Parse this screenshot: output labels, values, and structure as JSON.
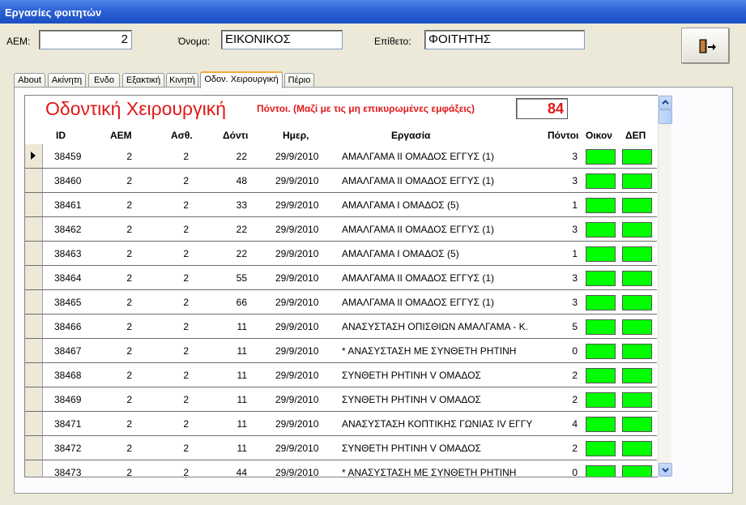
{
  "window": {
    "title": "Εργασίες φοιτητών"
  },
  "form": {
    "aem_label": "ΑΕΜ:",
    "aem_value": "2",
    "name_label": "Όνομα:",
    "name_value": "ΕΙΚΟΝΙΚΟΣ",
    "surname_label": "Επίθετο:",
    "surname_value": "ΦΟΙΤΗΤΗΣ"
  },
  "exit_button": {
    "icon": "exit-door-icon"
  },
  "tabs": [
    {
      "label": "About"
    },
    {
      "label": "Ακίνητη"
    },
    {
      "label": "Ενδο"
    },
    {
      "label": "Εξακτική"
    },
    {
      "label": "Κινητή"
    },
    {
      "label": "Οδον. Χειρουργική"
    },
    {
      "label": "Πέριο"
    }
  ],
  "subform": {
    "title": "Οδοντική Χειρουργική",
    "points_note": "Πόντοι. (Μαζί με τις μη επικυρωμένες εμφάξεις)",
    "points_total": "84",
    "columns": [
      "ID",
      "ΑΕΜ",
      "Ασθ.",
      "Δόντι",
      "Ημερ,",
      "Εργασία",
      "Πόντοι",
      "Οικον",
      "ΔΕΠ"
    ],
    "check_color": "#00ff00",
    "rows": [
      {
        "id": "38459",
        "aem": "2",
        "patient": "2",
        "tooth": "22",
        "date": "29/9/2010",
        "task": "ΑΜΑΛΓΑΜΑ ΙΙ ΟΜΑΔΟΣ ΕΓΓΥΣ (1)",
        "points": "3"
      },
      {
        "id": "38460",
        "aem": "2",
        "patient": "2",
        "tooth": "48",
        "date": "29/9/2010",
        "task": "ΑΜΑΛΓΑΜΑ ΙΙ ΟΜΑΔΟΣ ΕΓΓΥΣ (1)",
        "points": "3"
      },
      {
        "id": "38461",
        "aem": "2",
        "patient": "2",
        "tooth": "33",
        "date": "29/9/2010",
        "task": "ΑΜΑΛΓΑΜΑ Ι ΟΜΑΔΟΣ (5)",
        "points": "1"
      },
      {
        "id": "38462",
        "aem": "2",
        "patient": "2",
        "tooth": "22",
        "date": "29/9/2010",
        "task": "ΑΜΑΛΓΑΜΑ ΙΙ ΟΜΑΔΟΣ ΕΓΓΥΣ (1)",
        "points": "3"
      },
      {
        "id": "38463",
        "aem": "2",
        "patient": "2",
        "tooth": "22",
        "date": "29/9/2010",
        "task": "ΑΜΑΛΓΑΜΑ Ι ΟΜΑΔΟΣ (5)",
        "points": "1"
      },
      {
        "id": "38464",
        "aem": "2",
        "patient": "2",
        "tooth": "55",
        "date": "29/9/2010",
        "task": "ΑΜΑΛΓΑΜΑ ΙΙ ΟΜΑΔΟΣ ΕΓΓΥΣ (1)",
        "points": "3"
      },
      {
        "id": "38465",
        "aem": "2",
        "patient": "2",
        "tooth": "66",
        "date": "29/9/2010",
        "task": "ΑΜΑΛΓΑΜΑ ΙΙ ΟΜΑΔΟΣ ΕΓΓΥΣ (1)",
        "points": "3"
      },
      {
        "id": "38466",
        "aem": "2",
        "patient": "2",
        "tooth": "11",
        "date": "29/9/2010",
        "task": "ΑΝΑΣΥΣΤΑΣΗ ΟΠΙΣΘΙΩΝ ΑΜΑΛΓΑΜΑ - Κ.",
        "points": "5"
      },
      {
        "id": "38467",
        "aem": "2",
        "patient": "2",
        "tooth": "11",
        "date": "29/9/2010",
        "task": "* ΑΝΑΣΥΣΤΑΣΗ ΜΕ ΣΥΝΘΕΤΗ ΡΗΤΙΝΗ",
        "points": "0"
      },
      {
        "id": "38468",
        "aem": "2",
        "patient": "2",
        "tooth": "11",
        "date": "29/9/2010",
        "task": "ΣΥΝΘΕΤΗ ΡΗΤΙΝΗ V ΟΜΑΔΟΣ",
        "points": "2"
      },
      {
        "id": "38469",
        "aem": "2",
        "patient": "2",
        "tooth": "11",
        "date": "29/9/2010",
        "task": "ΣΥΝΘΕΤΗ ΡΗΤΙΝΗ V ΟΜΑΔΟΣ",
        "points": "2"
      },
      {
        "id": "38471",
        "aem": "2",
        "patient": "2",
        "tooth": "11",
        "date": "29/9/2010",
        "task": "ΑΝΑΣΥΣΤΑΣΗ ΚΟΠΤΙΚΗΣ ΓΩΝΙΑΣ ΙV ΕΓΓΥ",
        "points": "4"
      },
      {
        "id": "38472",
        "aem": "2",
        "patient": "2",
        "tooth": "11",
        "date": "29/9/2010",
        "task": "ΣΥΝΘΕΤΗ ΡΗΤΙΝΗ V ΟΜΑΔΟΣ",
        "points": "2"
      },
      {
        "id": "38473",
        "aem": "2",
        "patient": "2",
        "tooth": "44",
        "date": "29/9/2010",
        "task": "* ΑΝΑΣΥΣΤΑΣΗ ΜΕ ΣΥΝΘΕΤΗ ΡΗΤΙΝΗ",
        "points": "0"
      }
    ]
  }
}
